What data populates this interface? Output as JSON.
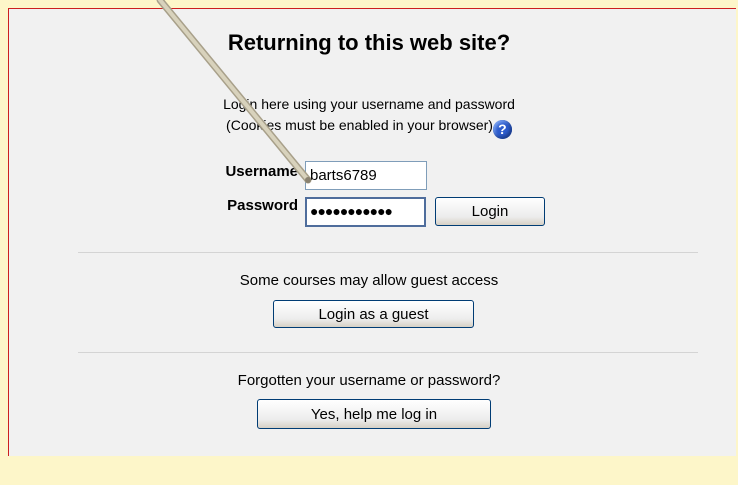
{
  "login": {
    "title": "Returning to this web site?",
    "instruction_line1": "Login here using your username and password",
    "instruction_line2": "(Cookies must be enabled in your browser)",
    "help_icon": "help-icon",
    "username_label": "Username",
    "username_value": "barts6789",
    "password_label": "Password",
    "password_masked": "●●●●●●●●●●●",
    "login_button": "Login"
  },
  "guest": {
    "text": "Some courses may allow guest access",
    "button": "Login as a guest"
  },
  "forgot": {
    "text": "Forgotten your username or password?",
    "button": "Yes, help me log in"
  },
  "colors": {
    "page_bg": "#fdf6c9",
    "panel_bg": "#f1f1f1",
    "panel_border": "#cc1f1f"
  }
}
